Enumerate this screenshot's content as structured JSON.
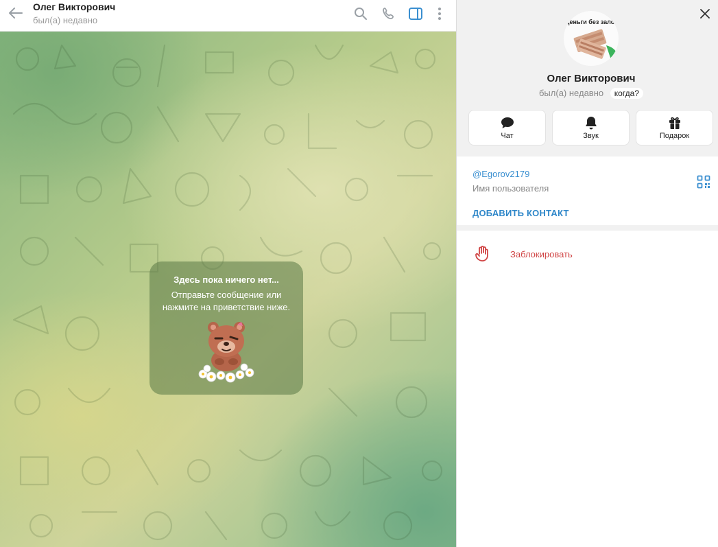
{
  "chat": {
    "title": "Олег Викторович",
    "status": "был(а) недавно",
    "empty_title": "Здесь пока ничего нет...",
    "empty_text": "Отправьте сообщение или нажмите на приветствие ниже."
  },
  "profile": {
    "avatar_text": "Деньги без залог",
    "name": "Олег Викторович",
    "status": "был(а) недавно",
    "when_label": "когда?",
    "actions": [
      {
        "label": "Чат",
        "icon": "chat-bubble-icon"
      },
      {
        "label": "Звук",
        "icon": "bell-icon"
      },
      {
        "label": "Подарок",
        "icon": "gift-icon"
      }
    ],
    "username": "@Egorov2179",
    "username_label": "Имя пользователя",
    "add_contact": "ДОБАВИТЬ КОНТАКТ",
    "block_label": "Заблокировать"
  },
  "colors": {
    "accent": "#3a8fd0",
    "danger": "#d04444",
    "header_icon": "#9aa0a6"
  }
}
